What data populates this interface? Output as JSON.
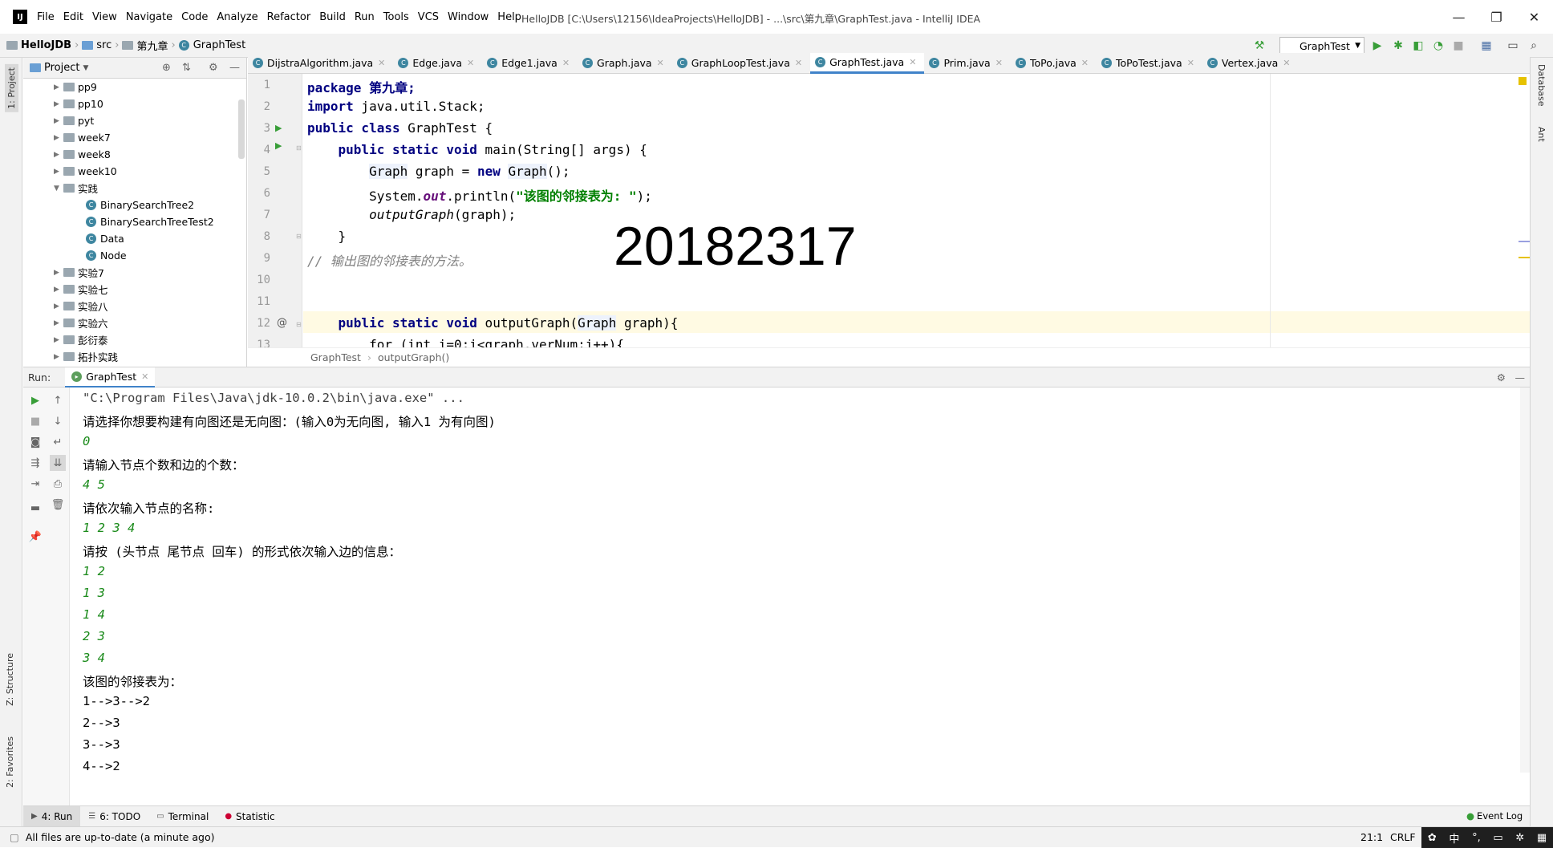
{
  "menu": [
    "File",
    "Edit",
    "View",
    "Navigate",
    "Code",
    "Analyze",
    "Refactor",
    "Build",
    "Run",
    "Tools",
    "VCS",
    "Window",
    "Help"
  ],
  "window_title": "HelloJDB [C:\\Users\\12156\\IdeaProjects\\HelloJDB] - ...\\src\\第九章\\GraphTest.java - IntelliJ IDEA",
  "breadcrumb": {
    "project": "HelloJDB",
    "src": "src",
    "pkg": "第九章",
    "cls": "GraphTest"
  },
  "run_config": "GraphTest",
  "project_panel": {
    "title": "Project"
  },
  "tree": [
    {
      "label": "pp9",
      "type": "folder",
      "indent": 0,
      "open": false
    },
    {
      "label": "pp10",
      "type": "folder",
      "indent": 0,
      "open": false
    },
    {
      "label": "pyt",
      "type": "folder",
      "indent": 0,
      "open": false
    },
    {
      "label": "week7",
      "type": "folder",
      "indent": 0,
      "open": false
    },
    {
      "label": "week8",
      "type": "folder",
      "indent": 0,
      "open": false
    },
    {
      "label": "week10",
      "type": "folder",
      "indent": 0,
      "open": false
    },
    {
      "label": "实践",
      "type": "folder",
      "indent": 0,
      "open": true
    },
    {
      "label": "BinarySearchTree2",
      "type": "class",
      "indent": 1
    },
    {
      "label": "BinarySearchTreeTest2",
      "type": "class",
      "indent": 1
    },
    {
      "label": "Data",
      "type": "class",
      "indent": 1
    },
    {
      "label": "Node",
      "type": "class",
      "indent": 1
    },
    {
      "label": "实验7",
      "type": "folder",
      "indent": 0,
      "open": false
    },
    {
      "label": "实验七",
      "type": "folder",
      "indent": 0,
      "open": false
    },
    {
      "label": "实验八",
      "type": "folder",
      "indent": 0,
      "open": false
    },
    {
      "label": "实验六",
      "type": "folder",
      "indent": 0,
      "open": false
    },
    {
      "label": "彭衍泰",
      "type": "folder",
      "indent": 0,
      "open": false
    },
    {
      "label": "拓扑实践",
      "type": "folder",
      "indent": 0,
      "open": false
    }
  ],
  "editor_tabs": [
    "DijstraAlgorithm.java",
    "Edge.java",
    "Edge1.java",
    "Graph.java",
    "GraphLoopTest.java",
    "GraphTest.java",
    "Prim.java",
    "ToPo.java",
    "ToPoTest.java",
    "Vertex.java"
  ],
  "active_tab": "GraphTest.java",
  "code": {
    "l1_kw": "package",
    "l1_rest": " 第九章;",
    "l2_kw": "import",
    "l2_rest": " java.util.Stack;",
    "l3_kw": "public class",
    "l3_rest": " GraphTest {",
    "l4_kw": "public static void",
    "l4_rest": " main(String[] args) {",
    "l5_a": "Graph",
    "l5_b": " graph = ",
    "l5_kw": "new",
    "l5_c": " ",
    "l5_d": "Graph",
    "l5_e": "();",
    "l6_a": "System.",
    "l6_b": "out",
    "l6_c": ".println(",
    "l6_str": "\"该图的邻接表为: \"",
    "l6_d": ");",
    "l7_a": "outputGraph",
    "l7_b": "(graph);",
    "l8": "}",
    "l9": "// 输出图的邻接表的方法。",
    "l12_kw": "public static void",
    "l12_a": " outputGraph(",
    "l12_b": "Graph",
    "l12_c": " graph){",
    "l13": "for (int i=0;i<graph.verNum;i++){"
  },
  "line_numbers": [
    "1",
    "2",
    "3",
    "4",
    "5",
    "6",
    "7",
    "8",
    "9",
    "10",
    "11",
    "12",
    "13"
  ],
  "watermark": "20182317",
  "editor_crumbs": {
    "a": "GraphTest",
    "b": "outputGraph()"
  },
  "run": {
    "label": "Run:",
    "tab": "GraphTest"
  },
  "console": [
    {
      "t": "\"C:\\Program Files\\Java\\jdk-10.0.2\\bin\\java.exe\" ...",
      "k": "cmd"
    },
    {
      "t": "请选择你想要构建有向图还是无向图：(输入0为无向图, 输入1 为有向图)",
      "k": "out"
    },
    {
      "t": "0",
      "k": "in"
    },
    {
      "t": "请输入节点个数和边的个数：",
      "k": "out"
    },
    {
      "t": "4 5",
      "k": "in"
    },
    {
      "t": "请依次输入节点的名称:",
      "k": "out"
    },
    {
      "t": "1 2 3 4",
      "k": "in"
    },
    {
      "t": "请按 (头节点 尾节点 回车) 的形式依次输入边的信息：",
      "k": "out"
    },
    {
      "t": "1 2",
      "k": "in"
    },
    {
      "t": "1 3",
      "k": "in"
    },
    {
      "t": "1 4",
      "k": "in"
    },
    {
      "t": "2 3",
      "k": "in"
    },
    {
      "t": "3 4",
      "k": "in"
    },
    {
      "t": "该图的邻接表为：",
      "k": "out"
    },
    {
      "t": "1-->3-->2",
      "k": "out"
    },
    {
      "t": "2-->3",
      "k": "out"
    },
    {
      "t": "3-->3",
      "k": "out"
    },
    {
      "t": "4-->2",
      "k": "out"
    }
  ],
  "bottom_tabs": [
    "4: Run",
    "6: TODO",
    "Terminal",
    "Statistic"
  ],
  "event_log": "Event Log",
  "status": {
    "msg": "All files are up-to-date (a minute ago)",
    "pos": "21:1",
    "eol": "CRLF"
  },
  "side_tabs": {
    "project": "1: Project",
    "structure": "Z: Structure",
    "favorites": "2: Favorites",
    "database": "Database",
    "ant": "Ant"
  },
  "tray": {
    "ime": "中"
  }
}
